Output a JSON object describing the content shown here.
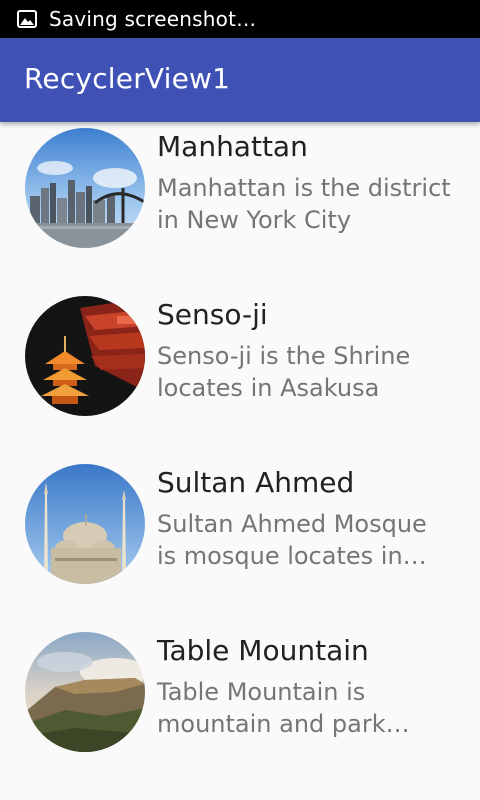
{
  "status_bar": {
    "text": "Saving screenshot…",
    "icon": "image-icon"
  },
  "app_bar": {
    "title": "RecyclerView1",
    "color": "#3f51b5"
  },
  "items": [
    {
      "title": "Manhattan",
      "description_lines": [
        "Manhattan is the district",
        "in New York City"
      ],
      "image": "manhattan-skyline-image"
    },
    {
      "title": "Senso-ji",
      "description_lines": [
        "Senso-ji is the Shrine",
        "locates in Asakusa"
      ],
      "image": "sensoji-temple-image"
    },
    {
      "title": "Sultan Ahmed",
      "description_lines": [
        "Sultan Ahmed Mosque",
        "is mosque locates in…"
      ],
      "image": "sultan-ahmed-mosque-image"
    },
    {
      "title": "Table Mountain",
      "description_lines": [
        "Table Mountain is",
        "mountain and park…"
      ],
      "image": "table-mountain-image"
    }
  ]
}
